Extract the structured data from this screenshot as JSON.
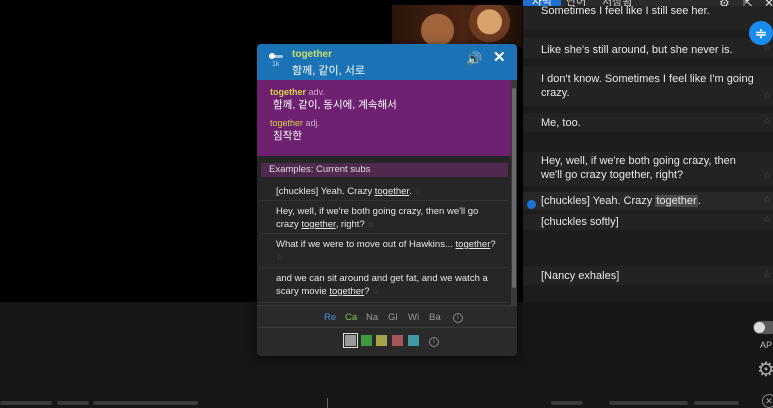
{
  "sidebar": {
    "tabs": [
      {
        "label": "자막"
      },
      {
        "label": "단어"
      },
      {
        "label": "저장됨"
      }
    ],
    "top_partial_line": "Sometimes I feel like I still see her.",
    "rows": [
      {
        "text": "Like she's still around, but she never is."
      },
      {
        "text": "I don't know. Sometimes I feel like I'm going crazy."
      },
      {
        "text": "Me, too."
      },
      {
        "text": "Hey, well, if we're both going crazy, then we'll go crazy together, right?"
      },
      {
        "before": "[chuckles] Yeah. Crazy ",
        "highlight": "together",
        "after": "."
      },
      {
        "text": "[chuckles softly]"
      },
      {
        "text": "[Nancy exhales]"
      }
    ],
    "icons": {
      "gear": "gear-icon",
      "popout": "popout-icon",
      "close": "close-icon",
      "stepper": "sync-icon"
    }
  },
  "popup": {
    "headword": "together",
    "rank": "1k",
    "gloss": "함께, 같이, 서로",
    "definitions": [
      {
        "word": "together",
        "pos": "adv.",
        "text": "함께, 같이, 동시에, 계속해서"
      },
      {
        "word": "together",
        "pos": "adj.",
        "text": "침착한"
      }
    ],
    "examples_heading": "Examples: Current subs",
    "examples": [
      {
        "before": "[chuckles] Yeah. Crazy ",
        "word": "together",
        "after": ". "
      },
      {
        "before": "Hey, well, if we're both going crazy, then we'll go crazy ",
        "word": "together",
        "after": ", right? "
      },
      {
        "before": "What if we were to move out of Hawkins... ",
        "word": "together",
        "after": "? "
      },
      {
        "before": "and we can sit around and get fat, and we watch a scary movie ",
        "word": "together",
        "after": "? "
      }
    ],
    "star": "☆",
    "source_tabs": [
      {
        "label": "Re",
        "color": "#4a90d9"
      },
      {
        "label": "Ca",
        "color": "#7ec850"
      },
      {
        "label": "Na",
        "color": "#9a9a9a"
      },
      {
        "label": "Gl",
        "color": "#9a9a9a"
      },
      {
        "label": "Wi",
        "color": "#9a9a9a"
      },
      {
        "label": "Ba",
        "color": "#9a9a9a"
      }
    ],
    "swatches": [
      "#9a9a9a",
      "#3f9a3f",
      "#a6a44a",
      "#a6555a",
      "#3f9aa6"
    ],
    "icons": {
      "speaker": "speaker-icon",
      "close": "close-icon",
      "info": "info-icon"
    }
  },
  "player": {
    "toggle_label": "AP"
  }
}
